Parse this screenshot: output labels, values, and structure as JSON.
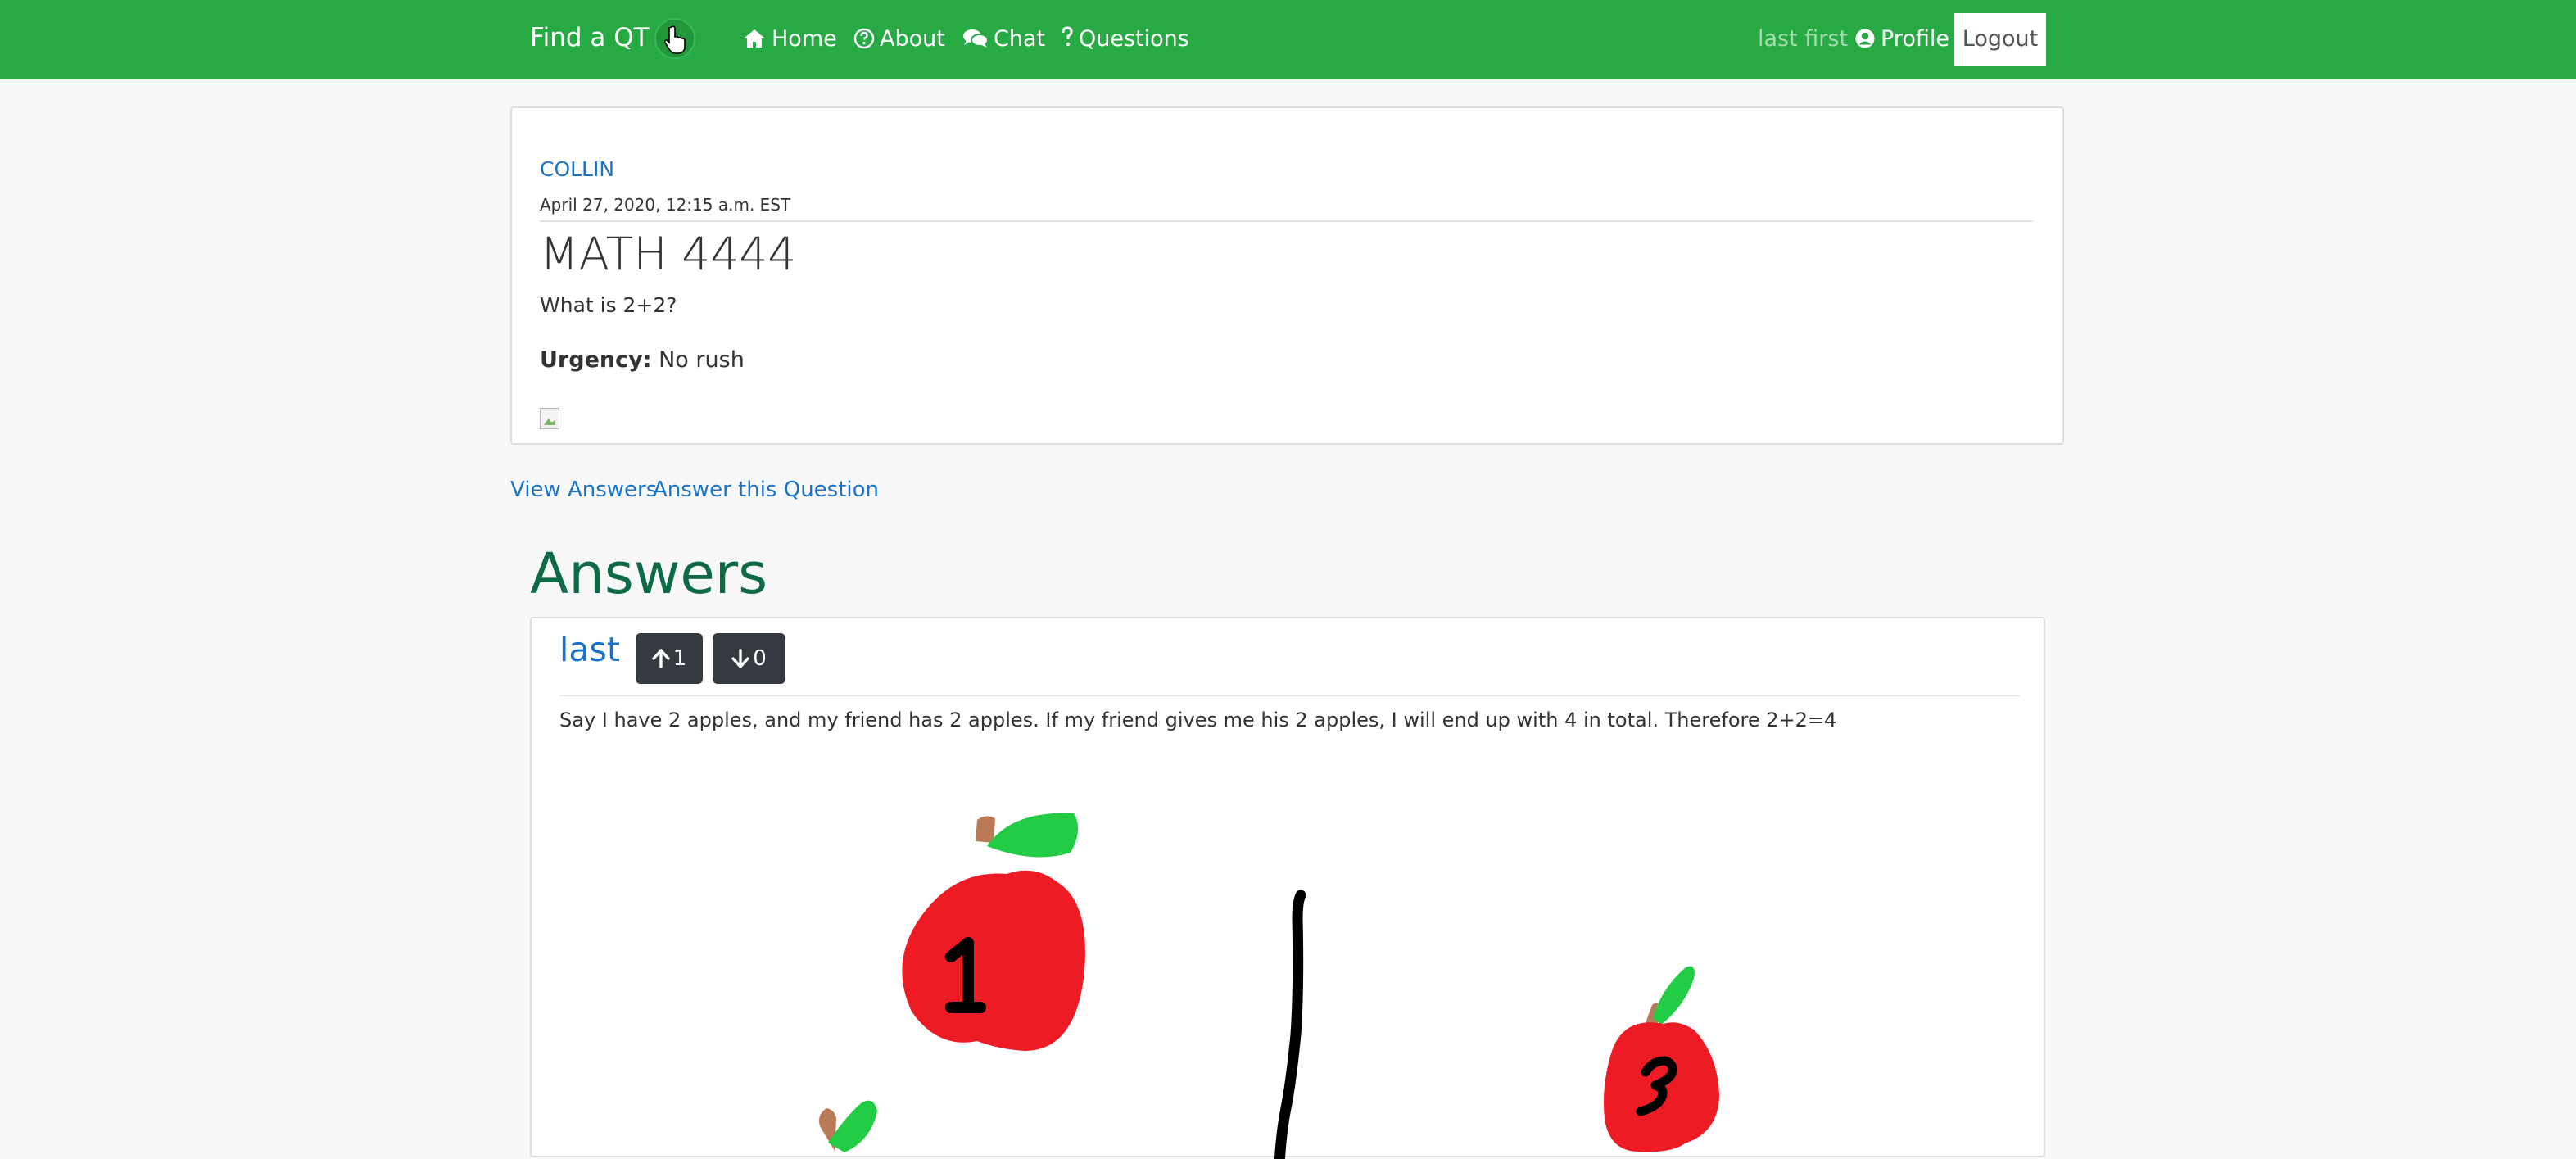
{
  "navbar": {
    "brand": "Find a QT",
    "links": [
      {
        "label": "Home",
        "icon": "home-icon"
      },
      {
        "label": "About",
        "icon": "question-circle-icon"
      },
      {
        "label": "Chat",
        "icon": "chat-icon"
      },
      {
        "label": "Questions",
        "icon": "question-mark-icon"
      }
    ],
    "user_name": "last first",
    "profile_label": "Profile",
    "logout_label": "Logout"
  },
  "question": {
    "author": "COLLIN",
    "date": "April 27, 2020, 12:15 a.m. EST",
    "title": "MATH 4444",
    "text": "What is 2+2?",
    "urgency_label": "Urgency:",
    "urgency_value": "No rush"
  },
  "actions": {
    "view_answers": "View Answers",
    "answer_question": "Answer this Question"
  },
  "answers": {
    "heading": "Answers",
    "items": [
      {
        "author": "last",
        "upvotes": "1",
        "downvotes": "0",
        "text": "Say I have 2 apples, and my friend has 2 apples. If my friend gives me his 2 apples, I will end up with 4 in total. Therefore 2+2=4"
      }
    ]
  },
  "colors": {
    "navbar": "#27a944",
    "link": "#1a73c9",
    "heading": "#0c6b45",
    "vote_button": "#343a40",
    "apple_red": "#ed1c24",
    "leaf_green": "#22cc44",
    "stem_brown": "#b97a57"
  }
}
